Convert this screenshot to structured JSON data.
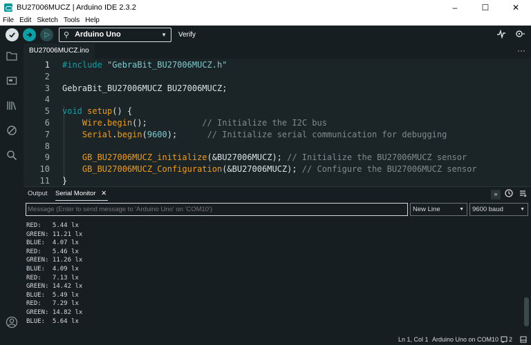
{
  "window": {
    "title": "BU27006MUCZ | Arduino IDE 2.3.2",
    "controls": [
      "–",
      "☐",
      "✕"
    ]
  },
  "menu": [
    "File",
    "Edit",
    "Sketch",
    "Tools",
    "Help"
  ],
  "toolbar": {
    "board": "Arduino Uno",
    "verify_label": "Verify"
  },
  "tabs": {
    "active": "BU27006MUCZ.ino",
    "more": "···"
  },
  "editor": {
    "current_line": 1,
    "lines": [
      {
        "n": "1",
        "tokens": [
          {
            "t": "#include",
            "c": "k-dir"
          },
          {
            "t": " ",
            "c": ""
          },
          {
            "t": "\"GebraBit_BU27006MUCZ.h\"",
            "c": "k-str"
          }
        ]
      },
      {
        "n": "2",
        "tokens": []
      },
      {
        "n": "3",
        "tokens": [
          {
            "t": "GebraBit_BU27006MUCZ BU27006MUCZ;",
            "c": ""
          }
        ]
      },
      {
        "n": "4",
        "tokens": []
      },
      {
        "n": "5",
        "tokens": [
          {
            "t": "void",
            "c": "k-kw"
          },
          {
            "t": " ",
            "c": ""
          },
          {
            "t": "setup",
            "c": "k-fn"
          },
          {
            "t": "() {",
            "c": ""
          }
        ]
      },
      {
        "n": "6",
        "tokens": [
          {
            "t": "    ",
            "c": ""
          },
          {
            "t": "Wire",
            "c": "k-fn"
          },
          {
            "t": ".",
            "c": ""
          },
          {
            "t": "begin",
            "c": "k-fn"
          },
          {
            "t": "();           ",
            "c": ""
          },
          {
            "t": "// Initialize the I2C bus",
            "c": "k-cm"
          }
        ]
      },
      {
        "n": "7",
        "tokens": [
          {
            "t": "    ",
            "c": ""
          },
          {
            "t": "Serial",
            "c": "k-fn"
          },
          {
            "t": ".",
            "c": ""
          },
          {
            "t": "begin",
            "c": "k-fn"
          },
          {
            "t": "(",
            "c": ""
          },
          {
            "t": "9600",
            "c": "k-num"
          },
          {
            "t": ");      ",
            "c": ""
          },
          {
            "t": "// Initialize serial communication for debugging",
            "c": "k-cm"
          }
        ]
      },
      {
        "n": "8",
        "tokens": []
      },
      {
        "n": "9",
        "tokens": [
          {
            "t": "    ",
            "c": ""
          },
          {
            "t": "GB_BU27006MUCZ_initialize",
            "c": "k-fn"
          },
          {
            "t": "(&BU27006MUCZ); ",
            "c": ""
          },
          {
            "t": "// Initialize the BU27006MUCZ sensor",
            "c": "k-cm"
          }
        ]
      },
      {
        "n": "10",
        "tokens": [
          {
            "t": "    ",
            "c": ""
          },
          {
            "t": "GB_BU27006MUCZ_Configuration",
            "c": "k-fn"
          },
          {
            "t": "(&BU27006MUCZ); ",
            "c": ""
          },
          {
            "t": "// Configure the BU27006MUCZ sensor",
            "c": "k-cm"
          }
        ]
      },
      {
        "n": "11",
        "tokens": [
          {
            "t": "}",
            "c": ""
          }
        ]
      }
    ]
  },
  "panel": {
    "tabs": [
      "Output",
      "Serial Monitor"
    ],
    "close_glyph": "✕",
    "message_placeholder": "Message (Enter to send message to 'Arduino Uno' on 'COM10')",
    "line_ending": "New Line",
    "baud": "9600 baud",
    "output": [
      "RED:   5.44 lx",
      "GREEN: 11.21 lx",
      "BLUE:  4.07 lx",
      "RED:   5.46 lx",
      "GREEN: 11.26 lx",
      "BLUE:  4.09 lx",
      "RED:   7.13 lx",
      "GREEN: 14.42 lx",
      "BLUE:  5.49 lx",
      "RED:   7.29 lx",
      "GREEN: 14.82 lx",
      "BLUE:  5.64 lx"
    ]
  },
  "status": {
    "cursor": "Ln 1, Col 1",
    "board_port": "Arduino Uno on COM10",
    "notifications": "2"
  },
  "colors": {
    "accent": "#0ca1a6",
    "function": "#f39c12",
    "background": "#1b2427"
  }
}
